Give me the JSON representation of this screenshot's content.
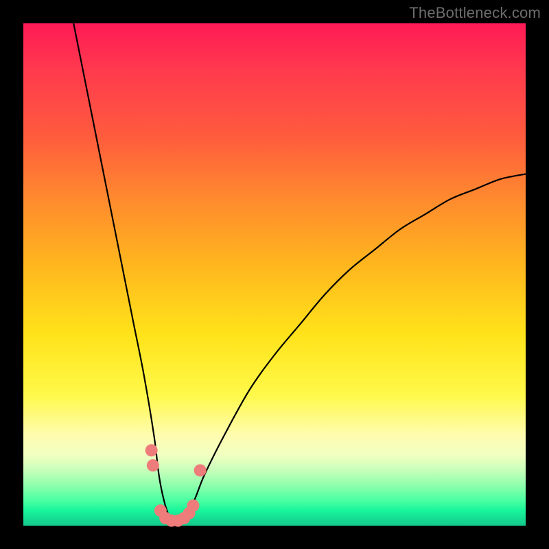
{
  "watermark": "TheBottleneck.com",
  "chart_data": {
    "type": "line",
    "title": "",
    "xlabel": "",
    "ylabel": "",
    "xlim": [
      0,
      100
    ],
    "ylim": [
      0,
      100
    ],
    "series": [
      {
        "name": "bottleneck-curve",
        "x": [
          10,
          12,
          14,
          16,
          18,
          20,
          22,
          24,
          26,
          27,
          28,
          29,
          30,
          31,
          32,
          34,
          36,
          40,
          45,
          50,
          55,
          60,
          65,
          70,
          75,
          80,
          85,
          90,
          95,
          100
        ],
        "y": [
          100,
          90,
          80,
          70,
          60,
          50,
          40,
          30,
          18,
          10,
          5,
          2,
          1,
          1,
          2,
          5,
          10,
          18,
          27,
          34,
          40,
          46,
          51,
          55,
          59,
          62,
          65,
          67,
          69,
          70
        ]
      }
    ],
    "markers": {
      "name": "highlight-dots",
      "color": "#ed7c7a",
      "points": [
        {
          "x": 25.5,
          "y": 15
        },
        {
          "x": 25.8,
          "y": 12
        },
        {
          "x": 27.3,
          "y": 3
        },
        {
          "x": 28.3,
          "y": 1.5
        },
        {
          "x": 29.5,
          "y": 1
        },
        {
          "x": 30.8,
          "y": 1
        },
        {
          "x": 32.0,
          "y": 1.5
        },
        {
          "x": 33.0,
          "y": 2.5
        },
        {
          "x": 33.8,
          "y": 4
        },
        {
          "x": 35.2,
          "y": 11
        }
      ]
    }
  }
}
